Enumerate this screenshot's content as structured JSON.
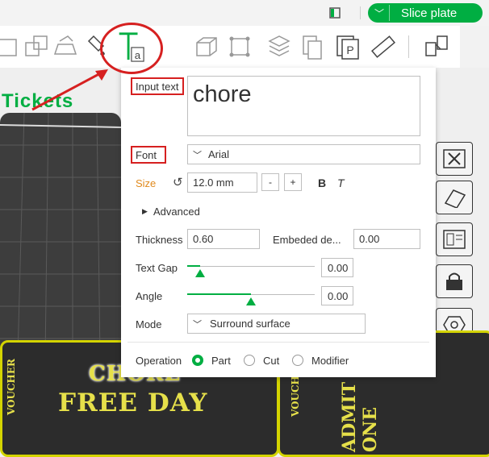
{
  "topbar": {
    "slice_label": "Slice plate",
    "chevron": "﹀"
  },
  "toolbar": {
    "tools": [
      "rotate-icon",
      "arrange-icon",
      "lay-flat-icon",
      "paint-icon",
      "text-tool-icon",
      "cube-icon",
      "scale-box-icon",
      "layers-icon",
      "copy-icon",
      "plate-icon",
      "measure-icon",
      "assembly-icon"
    ],
    "text_tool_glyph": "T",
    "text_tool_sub": "a",
    "plate_glyph": "P"
  },
  "viewport": {
    "tickets_label": "Tickets",
    "ticket_chore": "CHORE",
    "ticket_free_day": "FREE DAY",
    "voucher_left": "VOUCHER",
    "voucher_right": "VOUCHER",
    "admit": "ADMIT ONE"
  },
  "panel": {
    "input_text_label": "Input text",
    "input_text_value": "chore",
    "font_label": "Font",
    "font_value": "Arial",
    "font_chevron": "﹀",
    "size_label": "Size",
    "size_value": "12.0 mm",
    "minus": "-",
    "plus": "+",
    "bold": "B",
    "italic": "T",
    "advanced_label": "Advanced",
    "thickness_label": "Thickness",
    "thickness_value": "0.60",
    "embeded_label": "Embeded de...",
    "embeded_value": "0.00",
    "text_gap_label": "Text Gap",
    "text_gap_value": "0.00",
    "text_gap_level": 0.1,
    "angle_label": "Angle",
    "angle_value": "0.00",
    "angle_level": 0.5,
    "mode_label": "Mode",
    "mode_value": "Surround surface",
    "operation_label": "Operation",
    "op_part": "Part",
    "op_cut": "Cut",
    "op_modifier": "Modifier",
    "op_selected": "Part"
  },
  "colors": {
    "accent": "#00ae42",
    "annotation": "#d62020",
    "size_label": "#e08a1e"
  }
}
